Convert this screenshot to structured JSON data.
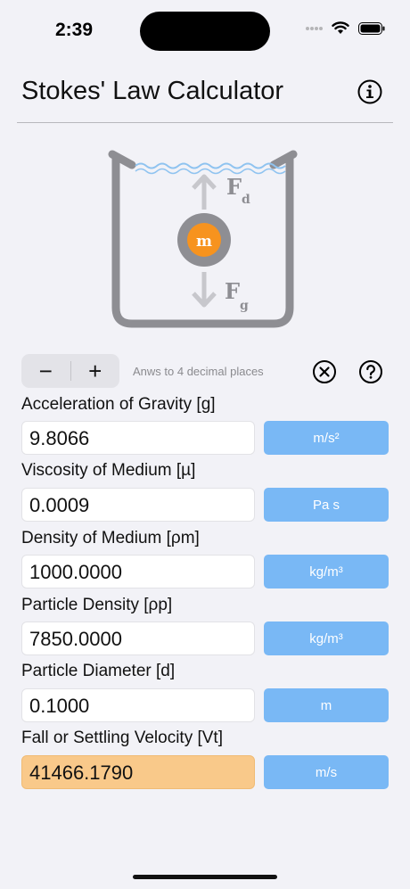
{
  "status_bar": {
    "time": "2:39"
  },
  "nav": {
    "title": "Stokes' Law Calculator",
    "info_icon": "info-circle-icon"
  },
  "diagram": {
    "drag_force_label": "F",
    "drag_force_sub": "d",
    "gravity_force_label": "F",
    "gravity_force_sub": "g",
    "mass_label": "m"
  },
  "controls": {
    "minus": "−",
    "plus": "+",
    "decimals_note": "Anws to 4 decimal places"
  },
  "fields": [
    {
      "label": "Acceleration of Gravity [g]",
      "value": "9.8066",
      "unit": "m/s²"
    },
    {
      "label": "Viscosity of Medium [µ]",
      "value": "0.0009",
      "unit": "Pa s"
    },
    {
      "label": "Density of Medium [ρm]",
      "value": "1000.0000",
      "unit": "kg/m³"
    },
    {
      "label": "Particle Density [ρp]",
      "value": "7850.0000",
      "unit": "kg/m³"
    },
    {
      "label": "Particle Diameter [d]",
      "value": "0.1000",
      "unit": "m"
    },
    {
      "label": "Fall or Settling Velocity [Vt]",
      "value": "41466.1790",
      "unit": "m/s"
    }
  ],
  "colors": {
    "accent_blue": "#79b8f5",
    "result_orange": "#f9c98a",
    "mass_orange": "#f7931e",
    "container_gray": "#8e8e93"
  }
}
